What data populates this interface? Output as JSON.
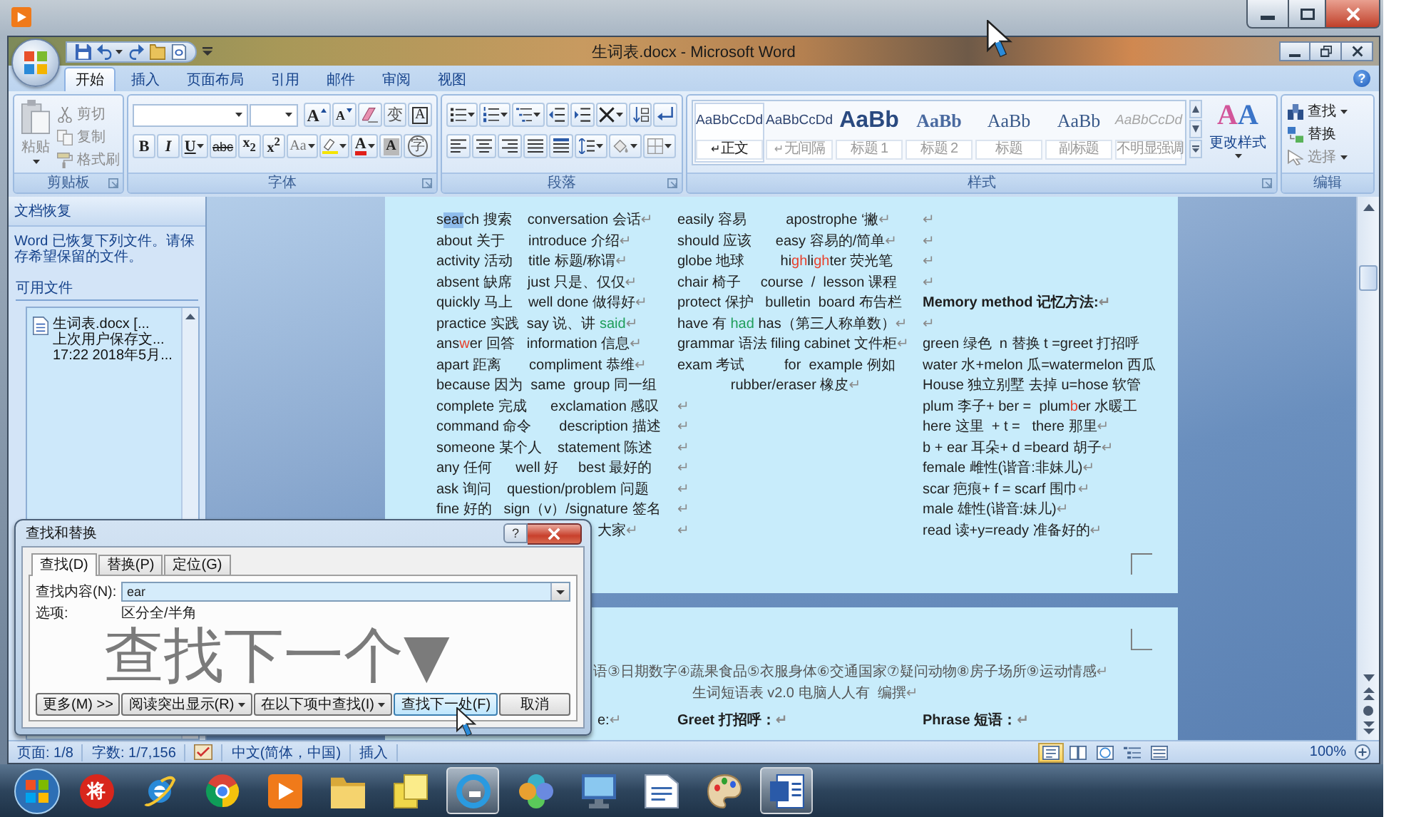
{
  "window": {
    "title": "生词表.docx - Microsoft Word",
    "help": "?"
  },
  "tabs": [
    {
      "label": "开始",
      "selected": true
    },
    {
      "label": "插入",
      "selected": false
    },
    {
      "label": "页面布局",
      "selected": false
    },
    {
      "label": "引用",
      "selected": false
    },
    {
      "label": "邮件",
      "selected": false
    },
    {
      "label": "审阅",
      "selected": false
    },
    {
      "label": "视图",
      "selected": false
    }
  ],
  "ribbon": {
    "clipboard": {
      "title": "剪贴板",
      "paste": {
        "label": "粘贴",
        "disabled": true
      },
      "items": [
        {
          "label": "剪切",
          "disabled": true
        },
        {
          "label": "复制",
          "disabled": true
        },
        {
          "label": "格式刷",
          "disabled": true
        }
      ]
    },
    "font": {
      "title": "字体",
      "row1": [
        {
          "kind": "grow",
          "label": "A"
        },
        {
          "kind": "shrink",
          "label": "A"
        },
        {
          "kind": "clear"
        },
        {
          "kind": "phonetic",
          "label": "变"
        },
        {
          "kind": "border",
          "label": "A"
        }
      ],
      "row2": [
        {
          "kind": "bold",
          "label": "B"
        },
        {
          "kind": "italic",
          "label": "I"
        },
        {
          "kind": "underline",
          "label": "U"
        },
        {
          "kind": "strike",
          "label": "abc"
        },
        {
          "kind": "subscript",
          "label": "x$_{2}$"
        },
        {
          "kind": "superscript",
          "label": "x$^{2}$"
        },
        {
          "kind": "case",
          "label": "Aa"
        },
        {
          "kind": "highlight"
        },
        {
          "kind": "color",
          "label": "A"
        },
        {
          "kind": "shade",
          "label": "A"
        },
        {
          "kind": "enclose",
          "label": "字"
        }
      ]
    },
    "paragraph": {
      "title": "段落"
    },
    "styles": {
      "title": "样式",
      "items": [
        {
          "kind": "body",
          "preview": "AaBbCcDd",
          "mark": "↵",
          "name": "正文",
          "selected": true
        },
        {
          "kind": "body",
          "preview": "AaBbCcDd",
          "mark": "↵",
          "name": "无间隔",
          "selected": false
        },
        {
          "kind": "heading1",
          "preview": "AaBb",
          "name": "标题 1",
          "selected": false
        },
        {
          "kind": "heading2",
          "preview": "AaBb",
          "name": "标题 2",
          "selected": false
        },
        {
          "kind": "title",
          "preview": "AaBb",
          "name": "标题",
          "selected": false
        },
        {
          "kind": "title",
          "preview": "AaBb",
          "name": "副标题",
          "selected": false
        },
        {
          "kind": "subtle",
          "preview": "AaBbCcDd",
          "name": "不明显强调",
          "selected": false
        }
      ],
      "change": {
        "letters": [
          "A",
          "A"
        ],
        "label": "更改样式"
      }
    },
    "editing": {
      "title": "编辑",
      "items": [
        {
          "label": "查找",
          "menu": true,
          "disabled": false
        },
        {
          "label": "替换",
          "menu": false,
          "disabled": false
        },
        {
          "label": "选择",
          "menu": true,
          "disabled": true
        }
      ]
    }
  },
  "recovery_pane": {
    "title": "文档恢复",
    "message": "Word 已恢复下列文件。请保存希望保留的文件。",
    "section": "可用文件",
    "files": [
      {
        "name": "生词表.docx [...",
        "status": "上次用户保存文...",
        "time": "17:22 2018年5月..."
      }
    ]
  },
  "document": {
    "pages": [
      {
        "columns": [
          [
            {
              "kind": "plain",
              "runs": [
                {
                  "kind": "plain",
                  "text": "s"
                },
                {
                  "kind": "match",
                  "text": "ear"
                },
                {
                  "kind": "plain",
                  "text": "ch 搜索    conversation 会话"
                }
              ],
              "end": "↵"
            },
            {
              "kind": "plain",
              "text": "about 关于      introduce 介绍",
              "end": "↵"
            },
            {
              "kind": "plain",
              "text": "activity 活动    title 标题/称谓",
              "end": "↵"
            },
            {
              "kind": "plain",
              "text": "absent 缺席    just 只是、仅仅",
              "end": "↵"
            },
            {
              "kind": "plain",
              "text": "quickly 马上    well done 做得好",
              "end": "↵"
            },
            {
              "kind": "plain",
              "runs": [
                {
                  "kind": "plain",
                  "text": "practice 实践  say 说、讲 "
                },
                {
                  "kind": "colored",
                  "text": "said",
                  "color": "#1f9e5a"
                }
              ],
              "end": "↵"
            },
            {
              "kind": "plain",
              "runs": [
                {
                  "kind": "plain",
                  "text": "ans"
                },
                {
                  "kind": "colored",
                  "text": "w",
                  "color": "#e8402c"
                },
                {
                  "kind": "plain",
                  "text": "er 回答   information 信息"
                }
              ],
              "end": "↵"
            },
            {
              "kind": "plain",
              "text": "apart 距离       compliment 恭维",
              "end": "↵"
            },
            {
              "kind": "plain",
              "text": "because 因为  same  group 同一组"
            },
            {
              "kind": "plain",
              "text": "complete 完成      exclamation 感叹"
            },
            {
              "kind": "plain",
              "text": "command 命令       description 描述"
            },
            {
              "kind": "plain",
              "text": "someone 某个人    statement 陈述"
            },
            {
              "kind": "plain",
              "text": "any 任何      well 好     best 最好的"
            },
            {
              "kind": "plain",
              "text": "ask 询问    question/problem 问题"
            },
            {
              "kind": "plain",
              "text": "fine 好的   sign（v）/signature 签名"
            },
            {
              "kind": "covered",
              "text": "大家",
              "end": "↵"
            }
          ],
          [
            {
              "kind": "plain",
              "text": "easily 容易          apostrophe ‘撇",
              "end": "↵"
            },
            {
              "kind": "plain",
              "text": "should 应该      easy 容易的/简单",
              "end": "↵"
            },
            {
              "kind": "plain",
              "runs": [
                {
                  "kind": "plain",
                  "text": "globe 地球         hi"
                },
                {
                  "kind": "colored",
                  "text": "gh",
                  "color": "#e8402c"
                },
                {
                  "kind": "plain",
                  "text": "li"
                },
                {
                  "kind": "colored",
                  "text": "gh",
                  "color": "#e8402c"
                },
                {
                  "kind": "plain",
                  "text": "ter 荧光笔"
                }
              ]
            },
            {
              "kind": "plain",
              "text": "chair 椅子     course  /  lesson 课程"
            },
            {
              "kind": "plain",
              "text": "protect 保护   bulletin  board 布告栏"
            },
            {
              "kind": "plain",
              "runs": [
                {
                  "kind": "plain",
                  "text": "have 有 "
                },
                {
                  "kind": "colored",
                  "text": "had",
                  "color": "#1f9e5a"
                },
                {
                  "kind": "plain",
                  "text": " has（第三人称单数）"
                }
              ],
              "end": "↵"
            },
            {
              "kind": "plain",
              "text": "grammar 语法 filing cabinet 文件柜",
              "end": "↵"
            },
            {
              "kind": "plain",
              "text": "exam 考试          for  example 例如"
            },
            {
              "kind": "centered",
              "text": "rubber/eraser 橡皮",
              "end": "↵"
            },
            {
              "kind": "plain",
              "end": "↵"
            },
            {
              "kind": "plain",
              "end": "↵"
            },
            {
              "kind": "plain",
              "end": "↵"
            },
            {
              "kind": "plain",
              "end": "↵"
            },
            {
              "kind": "plain",
              "end": "↵"
            },
            {
              "kind": "plain",
              "end": "↵"
            },
            {
              "kind": "plain",
              "end": "↵"
            }
          ],
          [
            {
              "kind": "plain",
              "end": "↵"
            },
            {
              "kind": "plain",
              "end": "↵"
            },
            {
              "kind": "plain",
              "end": "↵"
            },
            {
              "kind": "plain",
              "end": "↵"
            },
            {
              "kind": "heading",
              "text": "Memory method 记忆方法:",
              "end": "↵"
            },
            {
              "kind": "plain",
              "end": "↵"
            },
            {
              "kind": "plain",
              "text": "green 绿色  n 替换 t =greet 打招呼"
            },
            {
              "kind": "plain",
              "text": "water 水+melon 瓜=watermelon 西瓜"
            },
            {
              "kind": "plain",
              "text": "House 独立别墅 去掉 u=hose 软管"
            },
            {
              "kind": "plain",
              "runs": [
                {
                  "kind": "plain",
                  "text": "plum 李子+ ber =  plum"
                },
                {
                  "kind": "colored",
                  "text": "b",
                  "color": "#e8402c"
                },
                {
                  "kind": "plain",
                  "text": "er 水暖工"
                }
              ]
            },
            {
              "kind": "plain",
              "text": "here 这里  + t =   there 那里",
              "end": "↵"
            },
            {
              "kind": "plain",
              "text": "b + ear 耳朵+ d =beard 胡子",
              "end": "↵"
            },
            {
              "kind": "plain",
              "text": "female 雌性(谐音:非妹儿)",
              "end": "↵"
            },
            {
              "kind": "plain",
              "text": "scar 疤痕+ f = scarf 围巾",
              "end": "↵"
            },
            {
              "kind": "plain",
              "text": "male 雄性(谐音:妹儿)",
              "end": "↵"
            },
            {
              "kind": "plain",
              "text": "read 读+y=ready 准备好的",
              "end": "↵"
            }
          ]
        ]
      },
      {
        "lines": [
          {
            "kind": "covered",
            "text": "语③日期数字④蔬果食品⑤衣服身体⑥交通国家⑦疑问动物⑧房子场所⑨运动情感",
            "end": "↵"
          },
          {
            "kind": "centered",
            "text": "生词短语表 v2.0 电脑人人有  编撰",
            "end": "↵"
          }
        ],
        "columns": [
          [
            {
              "kind": "covered",
              "text": "e:",
              "end": "↵"
            }
          ],
          [
            {
              "kind": "heading",
              "text": "Greet 打招呼：",
              "end": "↵"
            }
          ],
          [
            {
              "kind": "heading",
              "text": "Phrase 短语：",
              "end": "↵"
            }
          ]
        ]
      }
    ]
  },
  "status_bar": {
    "page": "页面: 1/8",
    "words": "字数: 1/7,156",
    "language": "中文(简体，中国)",
    "mode": "插入",
    "views": [
      {
        "selected": true
      },
      {
        "selected": false
      },
      {
        "selected": false
      },
      {
        "selected": false
      },
      {
        "selected": false
      }
    ],
    "zoom": "100%"
  },
  "taskbar": {
    "buttons": [
      {
        "active": false,
        "label": "将"
      },
      {
        "active": false
      },
      {
        "active": false
      },
      {
        "active": false
      },
      {
        "active": false
      },
      {
        "active": false
      },
      {
        "active": true
      },
      {
        "active": false
      },
      {
        "active": false
      },
      {
        "active": false
      },
      {
        "active": false
      },
      {
        "active": true
      }
    ]
  },
  "find_dialog": {
    "title": "查找和替换",
    "help": "?",
    "tabs": [
      {
        "label": "查找(D)",
        "selected": true
      },
      {
        "label": "替换(P)",
        "selected": false
      },
      {
        "label": "定位(G)",
        "selected": false
      }
    ],
    "find_label": "查找内容(N):",
    "find_value": "ear",
    "options_label": "选项:",
    "options_value": "区分全/半角",
    "annotation": "查找下一个▼",
    "buttons": [
      {
        "kind": "plain",
        "label": "更多(M) >>"
      },
      {
        "kind": "menu",
        "label": "阅读突出显示(R)"
      },
      {
        "kind": "menu",
        "label": "在以下项中查找(I)"
      },
      {
        "kind": "default",
        "label": "查找下一处(F)"
      },
      {
        "kind": "plain",
        "label": "取消"
      }
    ]
  }
}
